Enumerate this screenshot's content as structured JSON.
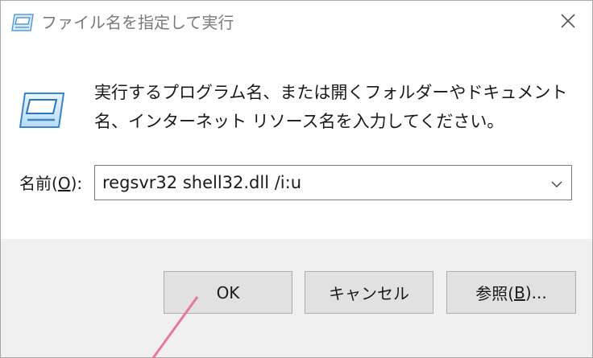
{
  "window": {
    "title": "ファイル名を指定して実行"
  },
  "content": {
    "message": "実行するプログラム名、または開くフォルダーやドキュメント名、インターネット リソース名を入力してください。",
    "name_label_prefix": "名前(",
    "name_label_accel": "O",
    "name_label_suffix": "):",
    "input_value": "regsvr32 shell32.dll /i:u"
  },
  "buttons": {
    "ok": "OK",
    "cancel": "キャンセル",
    "browse_prefix": "参照(",
    "browse_accel": "B",
    "browse_suffix": ")..."
  },
  "colors": {
    "pointer_arrow": "#e8789a",
    "footer_bg": "#f0f0f0",
    "button_bg": "#e1e1e1"
  },
  "icons": {
    "title": "run-icon",
    "close": "close-icon",
    "dropdown": "chevron-down-icon",
    "content": "run-icon"
  }
}
